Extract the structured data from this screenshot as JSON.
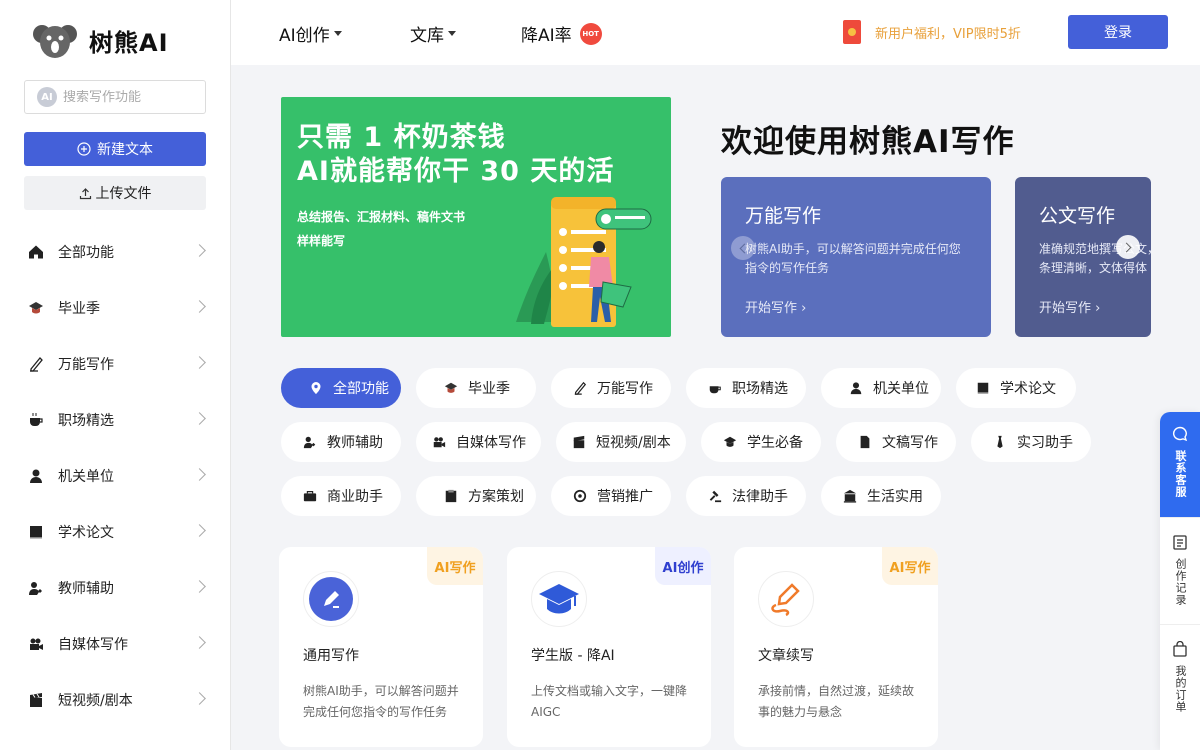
{
  "brand": {
    "name": "树熊AI"
  },
  "sidebar": {
    "search_placeholder": "搜索写作功能",
    "search_badge": "AI",
    "new_text": "新建文本",
    "upload_file": "上传文件",
    "items": [
      {
        "label": "全部功能",
        "icon": "home-icon"
      },
      {
        "label": "毕业季",
        "icon": "graduation-cap-icon"
      },
      {
        "label": "万能写作",
        "icon": "pen-icon"
      },
      {
        "label": "职场精选",
        "icon": "coffee-icon"
      },
      {
        "label": "机关单位",
        "icon": "person-icon"
      },
      {
        "label": "学术论文",
        "icon": "book-icon"
      },
      {
        "label": "教师辅助",
        "icon": "teacher-icon"
      },
      {
        "label": "自媒体写作",
        "icon": "camera-icon"
      },
      {
        "label": "短视频/剧本",
        "icon": "clapper-icon"
      }
    ]
  },
  "topbar": {
    "nav": [
      {
        "label": "AI创作"
      },
      {
        "label": "文库"
      },
      {
        "label": "降AI率",
        "badge": "HOT"
      }
    ],
    "promo": "新用户福利，VIP限时5折",
    "login": "登录"
  },
  "banner": {
    "line1": "只需 1 杯奶茶钱",
    "line2": "AI就能帮你干 30 天的活",
    "sub1": "总结报告、汇报材料、稿件文书",
    "sub2": "样样能写"
  },
  "welcome": "欢迎使用树熊AI写作",
  "carousel": [
    {
      "title": "万能写作",
      "desc": "树熊AI助手，可以解答问题并完成任何您指令的写作任务",
      "link": "开始写作 ›",
      "color": "#5b6fbd"
    },
    {
      "title": "公文写作",
      "desc": "准确规范地撰写公文，条理清晰，文体得体",
      "link": "开始写作 ›",
      "color": "#515c8f"
    }
  ],
  "chips": [
    {
      "label": "全部功能",
      "icon": "location-pin-icon",
      "active": true
    },
    {
      "label": "毕业季",
      "icon": "graduation-cap-icon"
    },
    {
      "label": "万能写作",
      "icon": "pen-icon"
    },
    {
      "label": "职场精选",
      "icon": "coffee-icon"
    },
    {
      "label": "机关单位",
      "icon": "person-icon"
    },
    {
      "label": "学术论文",
      "icon": "book-icon"
    },
    {
      "label": "教师辅助",
      "icon": "teacher-icon"
    },
    {
      "label": "自媒体写作",
      "icon": "camera-icon"
    },
    {
      "label": "短视频/剧本",
      "icon": "clapper-icon"
    },
    {
      "label": "学生必备",
      "icon": "graduation-cap-icon"
    },
    {
      "label": "文稿写作",
      "icon": "document-icon"
    },
    {
      "label": "实习助手",
      "icon": "tie-icon"
    },
    {
      "label": "商业助手",
      "icon": "briefcase-icon"
    },
    {
      "label": "方案策划",
      "icon": "clipboard-icon"
    },
    {
      "label": "营销推广",
      "icon": "target-icon"
    },
    {
      "label": "法律助手",
      "icon": "gavel-icon"
    },
    {
      "label": "生活实用",
      "icon": "building-icon"
    }
  ],
  "cards": [
    {
      "tag": "AI写作",
      "tag_color": "#f0a020",
      "title": "通用写作",
      "desc": "树熊AI助手，可以解答问题并完成任何您指令的写作任务",
      "icon": "edit-icon"
    },
    {
      "tag": "AI创作",
      "tag_color": "#2f3fcf",
      "title": "学生版 - 降AI",
      "desc": "上传文档或输入文字，一键降AIGC",
      "icon": "graduation-cap-icon"
    },
    {
      "tag": "AI写作",
      "tag_color": "#f0a020",
      "title": "文章续写",
      "desc": "承接前情，自然过渡，延续故事的魅力与悬念",
      "icon": "pen-curve-icon"
    }
  ],
  "float_panel": {
    "service": "联系客服",
    "history": "创作记录",
    "orders": "我的订单"
  },
  "colors": {
    "accent": "#4460d9",
    "banner_green": "#36c06a",
    "promo": "#e8a03a"
  }
}
